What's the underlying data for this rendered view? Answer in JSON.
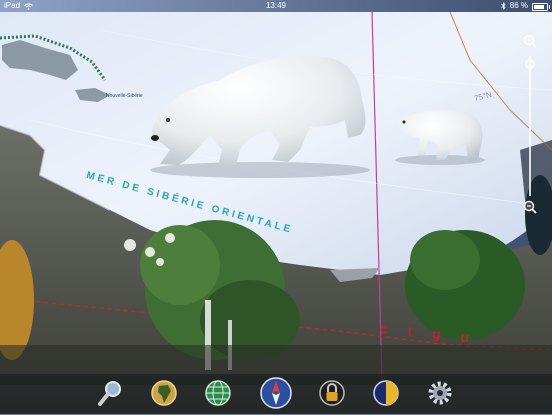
{
  "status_bar": {
    "device": "iPad",
    "time": "13:49",
    "battery_text": "86 %",
    "battery_level": 0.86,
    "wifi_icon": "wifi-icon",
    "bluetooth_icon": "bluetooth-icon"
  },
  "map": {
    "sea_label": "MER DE SIBÉRIE ORIENTALE",
    "region_label": "Nouvelle-Sibérie",
    "latitude_label": "75°N",
    "foreground_red_letters": "c  t  g  u"
  },
  "zoom": {
    "zoom_in_icon": "zoom-in-icon",
    "zoom_out_icon": "zoom-out-icon",
    "level": 0.05
  },
  "toolbar": {
    "buttons": [
      {
        "name": "search-button",
        "icon": "magnifier-icon"
      },
      {
        "name": "continents-button",
        "icon": "africa-globe-icon"
      },
      {
        "name": "globe-grid-button",
        "icon": "globe-grid-icon"
      },
      {
        "name": "compass-button",
        "icon": "compass-icon"
      },
      {
        "name": "lock-button",
        "icon": "padlock-icon"
      },
      {
        "name": "day-night-button",
        "icon": "day-night-icon"
      },
      {
        "name": "settings-button",
        "icon": "gear-icon"
      }
    ]
  }
}
